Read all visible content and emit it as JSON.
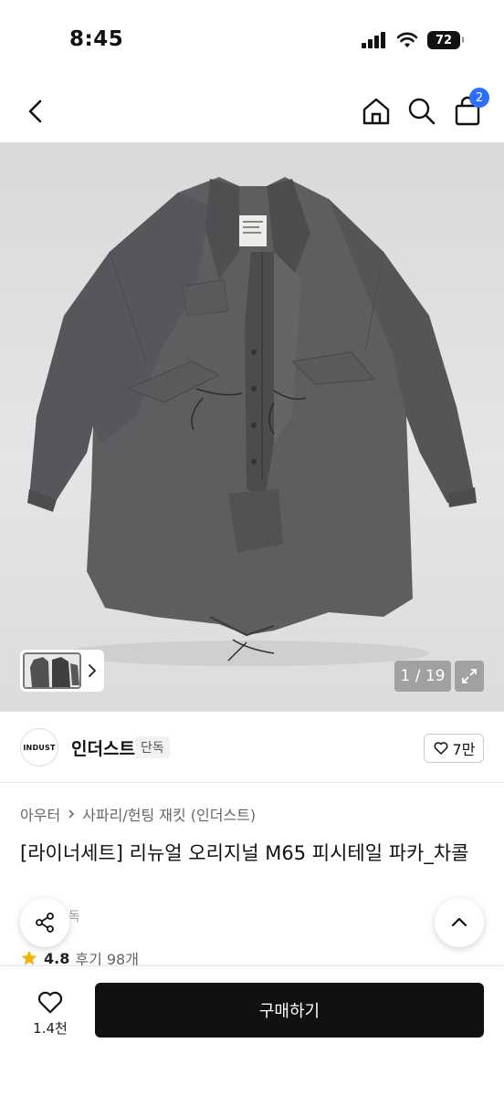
{
  "status_bar": {
    "time": "8:45",
    "battery": "72"
  },
  "nav": {
    "cart_count": "2"
  },
  "gallery": {
    "counter": "1 / 19"
  },
  "brand": {
    "logo_text": "INDUST",
    "name": "인더스트",
    "tag": "단독",
    "likes": "7만"
  },
  "breadcrumb": {
    "parent": "아우터",
    "child": "사파리/헌팅 재킷 (인더스트)"
  },
  "product": {
    "title": "[라이너세트] 리뉴얼 오리지널 M65 피시테일 파카_차콜",
    "hidden_tag": "단독",
    "rating": "4.8",
    "reviews": "후기 98개"
  },
  "bottom": {
    "wish_count": "1.4천",
    "buy_label": "구매하기"
  },
  "colors": {
    "accent": "#2f6fff",
    "star": "#f5b400",
    "buy_bg": "#111111"
  }
}
